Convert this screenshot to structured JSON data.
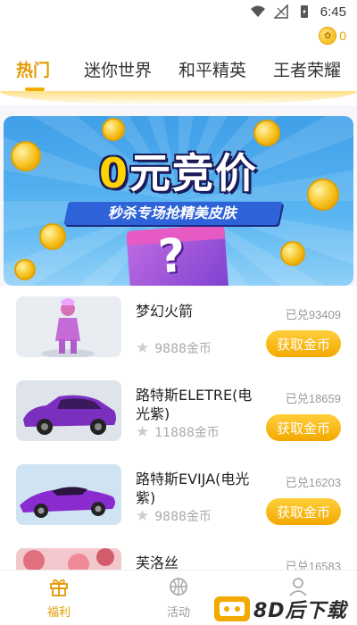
{
  "status_bar": {
    "time": "6:45"
  },
  "header": {
    "coin_count": "0",
    "tabs": [
      {
        "label": "热门",
        "active": true
      },
      {
        "label": "迷你世界",
        "active": false
      },
      {
        "label": "和平精英",
        "active": false
      },
      {
        "label": "王者荣耀",
        "active": false
      }
    ]
  },
  "banner": {
    "title_zero": "0",
    "title_rest": "元竞价",
    "subtitle": "秒杀专场抢精美皮肤",
    "box_symbol": "?"
  },
  "items": [
    {
      "name": "梦幻火箭",
      "redeemed": "已兑93409",
      "price": "9888金币",
      "button": "获取金币",
      "image_icon": "pink-character-icon"
    },
    {
      "name": "路特斯ELETRE(电光紫)",
      "redeemed": "已兑18659",
      "price": "11888金币",
      "button": "获取金币",
      "image_icon": "purple-suv-icon"
    },
    {
      "name": "路特斯EVIJA(电光紫)",
      "redeemed": "已兑16203",
      "price": "9888金币",
      "button": "获取金币",
      "image_icon": "purple-sportscar-icon"
    },
    {
      "name": "芙洛丝",
      "redeemed": "已兑16583",
      "price": "",
      "button": "",
      "image_icon": "pink-character-icon"
    }
  ],
  "bottom_nav": [
    {
      "label": "福利",
      "active": true,
      "icon": "gift-icon"
    },
    {
      "label": "活动",
      "active": false,
      "icon": "basketball-icon"
    },
    {
      "label": "",
      "active": false,
      "icon": "profile-icon"
    }
  ],
  "watermark": {
    "text": "8D后下载"
  },
  "colors": {
    "accent": "#f3ac00",
    "accent_text": "#e39a00",
    "button_top": "#ffcf3a",
    "button_bottom": "#f4a800"
  }
}
